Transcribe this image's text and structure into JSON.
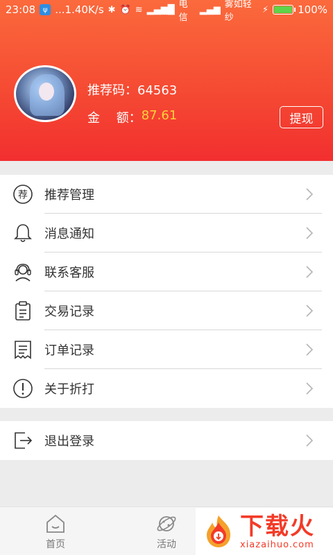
{
  "status_bar": {
    "time": "23:08",
    "dots": "...",
    "speed": "1.40K/s",
    "carrier1": "电信",
    "carrier2": "雾如轻纱",
    "battery": "100%"
  },
  "profile": {
    "referral_label": "推荐码：",
    "referral_code": "64563",
    "balance_label": "金　 额：",
    "balance_value": "87.61",
    "withdraw_button": "提现"
  },
  "menu": {
    "items": [
      {
        "label": "推荐管理",
        "icon": "recommend-icon"
      },
      {
        "label": "消息通知",
        "icon": "bell-icon"
      },
      {
        "label": "联系客服",
        "icon": "customer-service-icon"
      },
      {
        "label": "交易记录",
        "icon": "clipboard-icon"
      },
      {
        "label": "订单记录",
        "icon": "receipt-icon"
      },
      {
        "label": "关于折打",
        "icon": "info-icon"
      }
    ],
    "recommend_glyph": "荐"
  },
  "logout": {
    "label": "退出登录",
    "icon": "logout-icon"
  },
  "bottom_nav": {
    "home": "首页",
    "activity": "活动"
  },
  "watermark": {
    "title": "下载火",
    "url": "xiazaihuo.com"
  },
  "colors": {
    "header_top": "#fb6a3c",
    "header_bottom": "#f22f2f",
    "balance_accent": "#ffd23b"
  }
}
